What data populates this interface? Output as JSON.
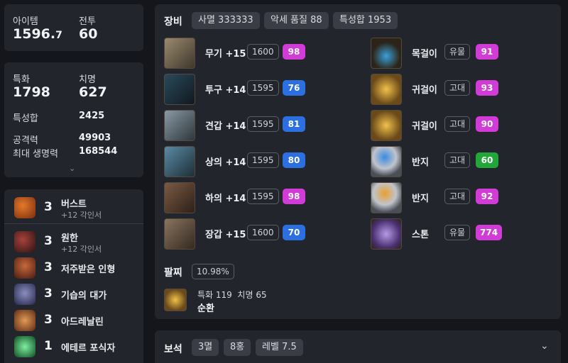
{
  "stats_top": {
    "item_label": "아이템",
    "item_value_main": "1596.",
    "item_value_dec": "7",
    "combat_label": "전투",
    "combat_value": "60"
  },
  "stats_mid": {
    "spec_label": "특화",
    "spec_value": "1798",
    "crit_label": "치명",
    "crit_value": "627",
    "total_label": "특성합",
    "total_value": "2425",
    "atk_label": "공격력",
    "atk_value": "49903",
    "hp_label": "최대 생명력",
    "hp_value": "168544"
  },
  "engravings": [
    {
      "level": "3",
      "name": "버스트",
      "sub": "+12 각인서",
      "icon_color": "#c2561d"
    },
    {
      "level": "3",
      "name": "원한",
      "sub": "+12 각인서",
      "icon_color": "#6a2a2a"
    },
    {
      "level": "3",
      "name": "저주받은 인형",
      "sub": "",
      "icon_color": "#8a3a24"
    },
    {
      "level": "3",
      "name": "기습의 대가",
      "sub": "",
      "icon_color": "#4c4f7a"
    },
    {
      "level": "3",
      "name": "아드레날린",
      "sub": "",
      "icon_color": "#b8612e"
    },
    {
      "level": "1",
      "name": "에테르 포식자",
      "sub": "",
      "icon_color": "#2f8a4a"
    }
  ],
  "equipment": {
    "title": "장비",
    "pills": [
      "사멸 333333",
      "악세 품질 88",
      "특성합 1953"
    ],
    "left": [
      {
        "name": "무기 +15",
        "ilvl": "1600",
        "quality": "98",
        "color": "mag"
      },
      {
        "name": "투구 +14",
        "ilvl": "1595",
        "quality": "76",
        "color": "blue"
      },
      {
        "name": "견갑 +14",
        "ilvl": "1595",
        "quality": "81",
        "color": "blue"
      },
      {
        "name": "상의 +14",
        "ilvl": "1595",
        "quality": "80",
        "color": "blue"
      },
      {
        "name": "하의 +14",
        "ilvl": "1595",
        "quality": "98",
        "color": "mag"
      },
      {
        "name": "장갑 +15",
        "ilvl": "1600",
        "quality": "70",
        "color": "blue"
      }
    ],
    "right": [
      {
        "name": "목걸이",
        "tier": "유물",
        "quality": "91",
        "color": "mag"
      },
      {
        "name": "귀걸이",
        "tier": "고대",
        "quality": "93",
        "color": "mag"
      },
      {
        "name": "귀걸이",
        "tier": "고대",
        "quality": "90",
        "color": "mag"
      },
      {
        "name": "반지",
        "tier": "고대",
        "quality": "60",
        "color": "green"
      },
      {
        "name": "반지",
        "tier": "고대",
        "quality": "92",
        "color": "mag"
      },
      {
        "name": "스톤",
        "tier": "유물",
        "quality": "774",
        "color": "mag"
      }
    ],
    "bracelet_title": "팔찌",
    "bracelet_pct": "10.98%",
    "bracelet_stats": "특화 119  치명 65",
    "bracelet_effect": "순환"
  },
  "gems": {
    "title": "보석",
    "pills": [
      "3멸",
      "8홍",
      "레벨 7.5"
    ]
  }
}
